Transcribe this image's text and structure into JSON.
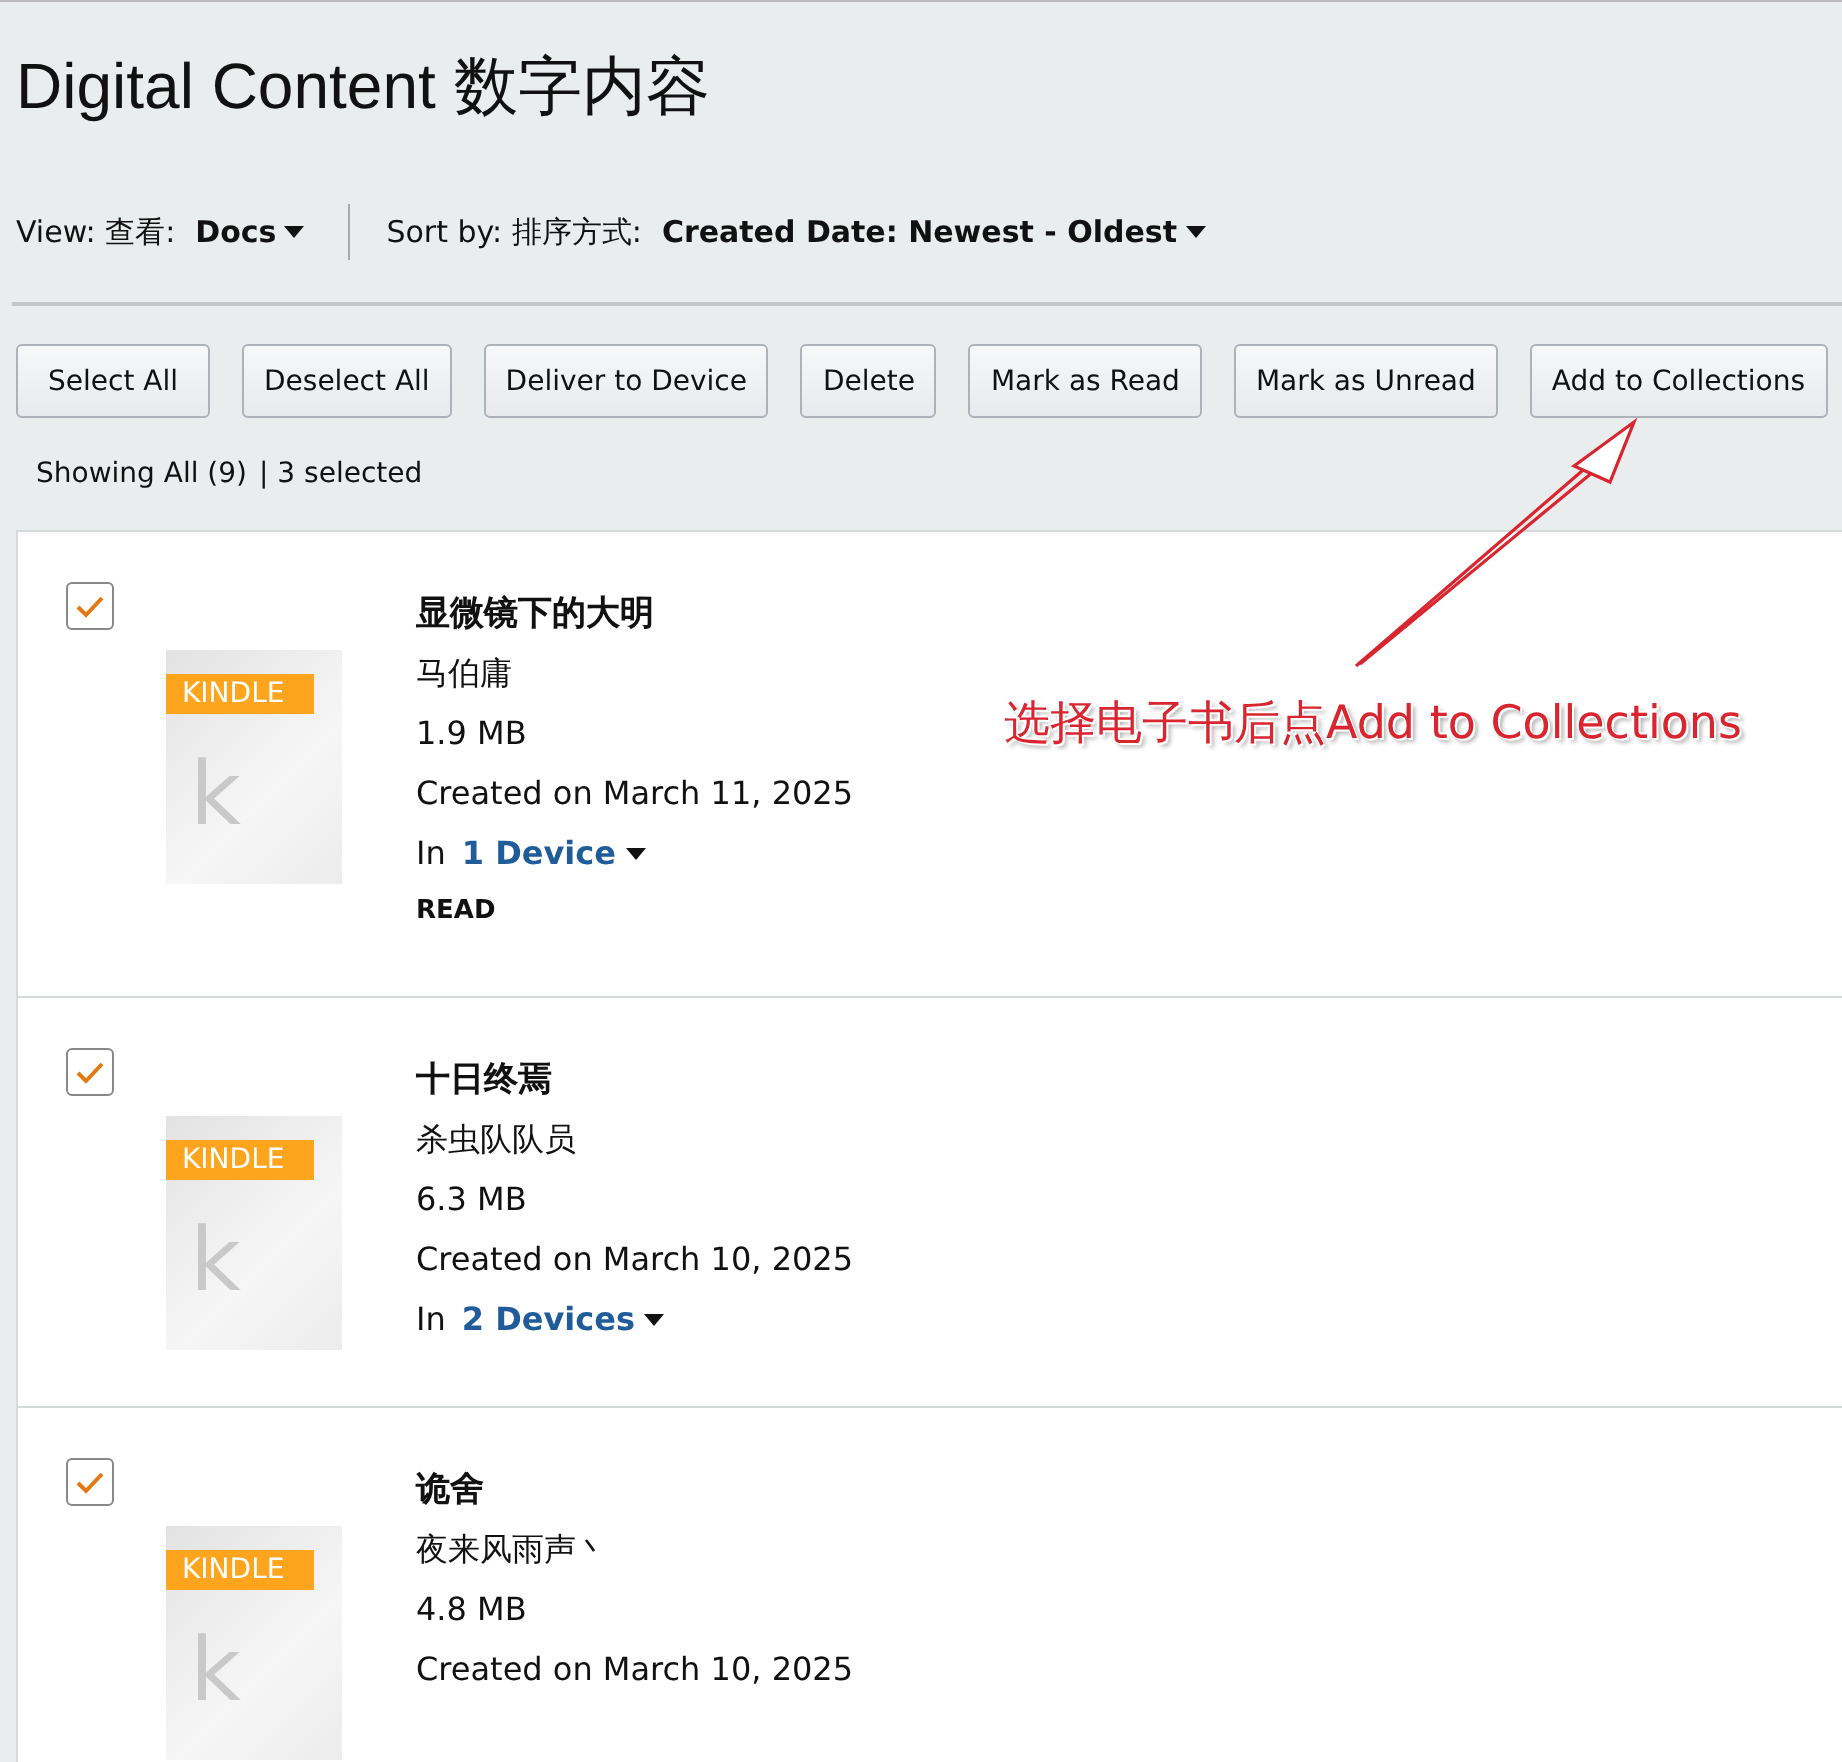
{
  "title": "Digital Content 数字内容",
  "view": {
    "label": "View: 查看:",
    "value": "Docs"
  },
  "sort": {
    "label": "Sort by: 排序方式:",
    "value": "Created Date: Newest - Oldest"
  },
  "buttons": [
    "Select All",
    "Deselect All",
    "Deliver to Device",
    "Delete",
    "Mark as Read",
    "Mark as Unread",
    "Add to Collections"
  ],
  "showing": "Showing All (9)",
  "selected_count": "| 3 selected",
  "items": [
    {
      "selected": true,
      "cover_badge": "KINDLE",
      "cover_letter": "k",
      "title": "显微镜下的大明",
      "author": "马伯庸",
      "size": "1.9 MB",
      "created": "Created on March 11, 2025",
      "device_prefix": "In",
      "device_link": "1 Device",
      "status": "READ"
    },
    {
      "selected": true,
      "cover_badge": "KINDLE",
      "cover_letter": "k",
      "title": "十日终焉",
      "author": "杀虫队队员",
      "size": "6.3 MB",
      "created": "Created on March 10, 2025",
      "device_prefix": "In",
      "device_link": "2 Devices"
    },
    {
      "selected": true,
      "cover_badge": "KINDLE",
      "cover_letter": "k",
      "title": "诡舍",
      "author": "夜来风雨声丶",
      "size": "4.8 MB",
      "created": "Created on March 10, 2025"
    }
  ],
  "annotation": {
    "text": "选择电子书后点Add to Collections"
  }
}
